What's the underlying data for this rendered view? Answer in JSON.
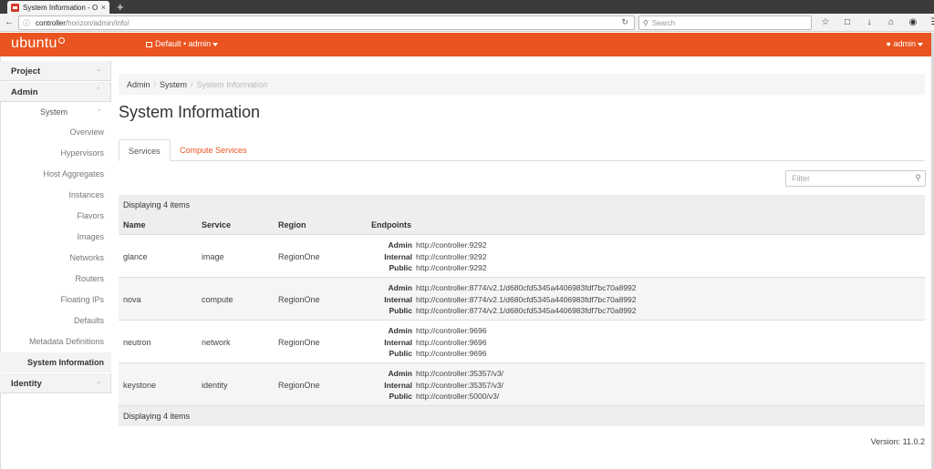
{
  "browser": {
    "tab_title": "System Information - O",
    "tab_close": "×",
    "new_tab": "+",
    "url_host": "controller",
    "url_path": "/horizon/admin/info/",
    "search_placeholder": "Search",
    "icons": [
      "star-icon",
      "clipboard-icon",
      "download-icon",
      "home-icon",
      "pocket-icon",
      "menu-icon"
    ]
  },
  "header": {
    "logo": "ubuntu",
    "project_switch": "Default • admin",
    "user_menu": "admin",
    "brand_color": "#e95420"
  },
  "sidebar": {
    "groups": {
      "project": "Project",
      "admin": "Admin",
      "identity": "Identity"
    },
    "system_label": "System",
    "items": [
      "Overview",
      "Hypervisors",
      "Host Aggregates",
      "Instances",
      "Flavors",
      "Images",
      "Networks",
      "Routers",
      "Floating IPs",
      "Defaults",
      "Metadata Definitions"
    ],
    "active_item": "System Information"
  },
  "breadcrumb": {
    "items": [
      "Admin",
      "System"
    ],
    "current": "System Information",
    "sep": "/"
  },
  "page_title": "System Information",
  "tabs": {
    "services": "Services",
    "compute_services": "Compute Services"
  },
  "filter": {
    "placeholder": "Filter"
  },
  "table": {
    "caption": "Displaying 4 items",
    "footer": "Displaying 4 items",
    "columns": {
      "name": "Name",
      "service": "Service",
      "region": "Region",
      "endpoints": "Endpoints"
    },
    "endpoint_labels": {
      "admin": "Admin",
      "internal": "Internal",
      "public": "Public"
    },
    "rows": [
      {
        "name": "glance",
        "service": "image",
        "region": "RegionOne",
        "admin": "http://controller:9292",
        "internal": "http://controller:9292",
        "public": "http://controller:9292"
      },
      {
        "name": "nova",
        "service": "compute",
        "region": "RegionOne",
        "admin": "http://controller:8774/v2.1/d680cfd5345a4406983fdf7bc70a8992",
        "internal": "http://controller:8774/v2.1/d680cfd5345a4406983fdf7bc70a8992",
        "public": "http://controller:8774/v2.1/d680cfd5345a4406983fdf7bc70a8992"
      },
      {
        "name": "neutron",
        "service": "network",
        "region": "RegionOne",
        "admin": "http://controller:9696",
        "internal": "http://controller:9696",
        "public": "http://controller:9696"
      },
      {
        "name": "keystone",
        "service": "identity",
        "region": "RegionOne",
        "admin": "http://controller:35357/v3/",
        "internal": "http://controller:35357/v3/",
        "public": "http://controller:5000/v3/"
      }
    ]
  },
  "version": "Version: 11.0.2"
}
